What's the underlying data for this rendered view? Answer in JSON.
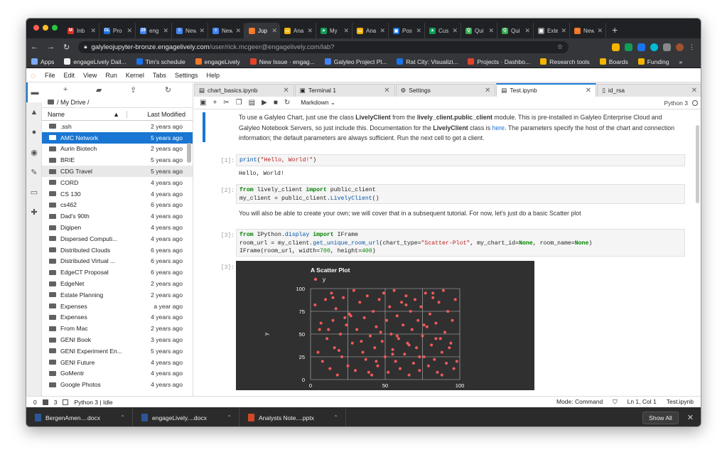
{
  "browser": {
    "tabs": [
      {
        "label": "Inb",
        "color": "#d93025",
        "letter": "M"
      },
      {
        "label": "Pro",
        "color": "#1a73e8",
        "letter": "GL"
      },
      {
        "label": "eng",
        "color": "#4285f4",
        "letter": "29"
      },
      {
        "label": "New",
        "color": "#4285f4",
        "letter": "≡"
      },
      {
        "label": "New",
        "color": "#4285f4",
        "letter": "≡"
      },
      {
        "label": "Jup",
        "color": "#f37726",
        "letter": "◌"
      },
      {
        "label": "Ana",
        "color": "#f4b400",
        "letter": "▭"
      },
      {
        "label": "My",
        "color": "#0f9d58",
        "letter": "▲"
      },
      {
        "label": "Ana",
        "color": "#f4b400",
        "letter": "▭"
      },
      {
        "label": "Pos",
        "color": "#1a73e8",
        "letter": "▣"
      },
      {
        "label": "Cus",
        "color": "#0f9d58",
        "letter": "▲"
      },
      {
        "label": "Qui",
        "color": "#34a853",
        "letter": "Q"
      },
      {
        "label": "Qui",
        "color": "#34a853",
        "letter": "Q"
      },
      {
        "label": "Exte",
        "color": "#888888",
        "letter": "▦"
      },
      {
        "label": "New",
        "color": "#f37726",
        "letter": "◌"
      }
    ],
    "active_tab_index": 5,
    "url_main": "galyleojupyter-bronze.engagelively.com",
    "url_rest": "/user/rick.mcgeer@engagelively.com/lab?",
    "bookmarks": [
      {
        "label": "Apps",
        "color": "#7baaf7"
      },
      {
        "label": "engageLively Dail...",
        "color": "#f1f1f1"
      },
      {
        "label": "Tim's schedule",
        "color": "#1a73e8"
      },
      {
        "label": "engageLively",
        "color": "#f37726"
      },
      {
        "label": "New Issue · engag...",
        "color": "#e24329"
      },
      {
        "label": "Galyleo Project Pl...",
        "color": "#4285f4"
      },
      {
        "label": "Rat City: Visualizi...",
        "color": "#1a73e8"
      },
      {
        "label": "Projects · Dashbo...",
        "color": "#e24329"
      },
      {
        "label": "Research tools",
        "color": "#f4b400"
      },
      {
        "label": "Boards",
        "color": "#f4b400"
      },
      {
        "label": "Funding",
        "color": "#f4b400"
      }
    ]
  },
  "lab": {
    "menu": [
      "File",
      "Edit",
      "View",
      "Run",
      "Kernel",
      "Tabs",
      "Settings",
      "Help"
    ],
    "breadcrumb": "/ My Drive /",
    "col_name": "Name",
    "col_modified": "Last Modified",
    "files": [
      {
        "name": ".ssh",
        "date": "2 years ago"
      },
      {
        "name": "AMC Network",
        "date": "5 years ago"
      },
      {
        "name": "Aurin Biotech",
        "date": "2 years ago"
      },
      {
        "name": "BRIE",
        "date": "5 years ago"
      },
      {
        "name": "CDG Travel",
        "date": "5 years ago"
      },
      {
        "name": "CORD",
        "date": "4 years ago"
      },
      {
        "name": "CS 130",
        "date": "4 years ago"
      },
      {
        "name": "cs462",
        "date": "6 years ago"
      },
      {
        "name": "Dad's 90th",
        "date": "4 years ago"
      },
      {
        "name": "Digipen",
        "date": "4 years ago"
      },
      {
        "name": "Dispersed Computi...",
        "date": "4 years ago"
      },
      {
        "name": "Distributed Clouds",
        "date": "6 years ago"
      },
      {
        "name": "Distributed Virtual ...",
        "date": "6 years ago"
      },
      {
        "name": "EdgeCT Proposal",
        "date": "6 years ago"
      },
      {
        "name": "EdgeNet",
        "date": "2 years ago"
      },
      {
        "name": "Estate Planning",
        "date": "2 years ago"
      },
      {
        "name": "Expenses",
        "date": "a year ago"
      },
      {
        "name": "Expenses",
        "date": "4 years ago"
      },
      {
        "name": "From Mac",
        "date": "2 years ago"
      },
      {
        "name": "GENI Book",
        "date": "3 years ago"
      },
      {
        "name": "GENI Experiment En...",
        "date": "5 years ago"
      },
      {
        "name": "GENI Future",
        "date": "4 years ago"
      },
      {
        "name": "GoMentr",
        "date": "4 years ago"
      },
      {
        "name": "Google Photos",
        "date": "4 years ago"
      }
    ],
    "doc_tabs": [
      {
        "label": "chart_basics.ipynb",
        "icon": "notebook-icon"
      },
      {
        "label": "Terminal 1",
        "icon": "terminal-icon"
      },
      {
        "label": "Settings",
        "icon": "gear-icon"
      },
      {
        "label": "Test.ipynb",
        "icon": "notebook-icon"
      },
      {
        "label": "id_rsa",
        "icon": "file-icon"
      }
    ],
    "cell_type": "Markdown",
    "kernel": "Python 3",
    "md1_a": "To use a Galyleo Chart, just use the class ",
    "md1_b": "LivelyClient",
    "md1_c": " from the ",
    "md1_d": "lively_client.public_client",
    "md1_e": " module. This is pre-installed in Galyleo Enterprise Cloud and Galyleo Notebook Servers, so just include this. Documentation for the ",
    "md1_f": "LivelyClient",
    "md1_g": " class is ",
    "md1_h": "here",
    "md1_i": ". The parameters specify the host of the chart and connection information; the default parameters are always sufficient. Run the next cell to get a client.",
    "p1": "[1]:",
    "p2": "[2]:",
    "p3": "[3]:",
    "p3o": "[3]:",
    "out1": "Hello, World!",
    "md2": "You will also be able to create your own; we will cover that in a subsequent tutorial. For now, let's just do a basic Scatter plot",
    "status": {
      "left_a": "0",
      "left_b": "3",
      "kernel_state": "Python 3 | Idle",
      "mode": "Mode: Command",
      "pos": "Ln 1, Col 1",
      "file": "Test.ipynb"
    }
  },
  "downloads": [
    {
      "label": "BergenAmen....docx",
      "color": "#2b579a"
    },
    {
      "label": "engageLively....docx",
      "color": "#2b579a"
    },
    {
      "label": "Analysts Note....pptx",
      "color": "#d24726"
    }
  ],
  "downloads_show_all": "Show All",
  "chart_data": {
    "type": "scatter",
    "title": "A Scatter Plot",
    "legend": [
      "y"
    ],
    "xlabel": "",
    "ylabel": "y",
    "xlim": [
      0,
      100
    ],
    "ylim": [
      0,
      100
    ],
    "xticks": [
      0,
      50,
      100
    ],
    "yticks": [
      0,
      25,
      50,
      75,
      100
    ],
    "grid": true,
    "background": "#303030",
    "point_color": "#f05a5a",
    "x": [
      3,
      5,
      6,
      8,
      10,
      11,
      13,
      14,
      15,
      16,
      17,
      18,
      20,
      21,
      22,
      24,
      25,
      26,
      28,
      29,
      30,
      31,
      33,
      35,
      36,
      37,
      38,
      40,
      41,
      42,
      43,
      44,
      45,
      46,
      48,
      49,
      50,
      51,
      52,
      53,
      54,
      55,
      56,
      57,
      58,
      59,
      60,
      61,
      62,
      63,
      64,
      65,
      66,
      67,
      68,
      69,
      70,
      71,
      72,
      73,
      74,
      75,
      76,
      77,
      78,
      79,
      80,
      81,
      82,
      83,
      84,
      85,
      86,
      87,
      88,
      89,
      90,
      91,
      92,
      94,
      95,
      96,
      97,
      98,
      7,
      19,
      27,
      39,
      47,
      58,
      66,
      73,
      84,
      93,
      12,
      23,
      34,
      44,
      64,
      76,
      88,
      15,
      55,
      82
    ],
    "y": [
      82,
      30,
      55,
      20,
      88,
      45,
      12,
      95,
      65,
      35,
      78,
      5,
      50,
      25,
      90,
      60,
      15,
      72,
      40,
      98,
      10,
      55,
      85,
      30,
      68,
      22,
      92,
      48,
      5,
      75,
      35,
      58,
      15,
      88,
      42,
      95,
      25,
      65,
      8,
      80,
      50,
      33,
      98,
      20,
      70,
      45,
      12,
      85,
      60,
      28,
      92,
      40,
      5,
      75,
      55,
      18,
      88,
      35,
      65,
      10,
      80,
      48,
      25,
      95,
      58,
      15,
      72,
      38,
      90,
      22,
      62,
      8,
      85,
      45,
      30,
      98,
      52,
      18,
      75,
      40,
      65,
      12,
      88,
      20,
      62,
      32,
      70,
      8,
      52,
      48,
      38,
      25,
      45,
      35,
      55,
      68,
      42,
      20,
      82,
      60,
      5,
      90,
      28,
      95
    ]
  }
}
